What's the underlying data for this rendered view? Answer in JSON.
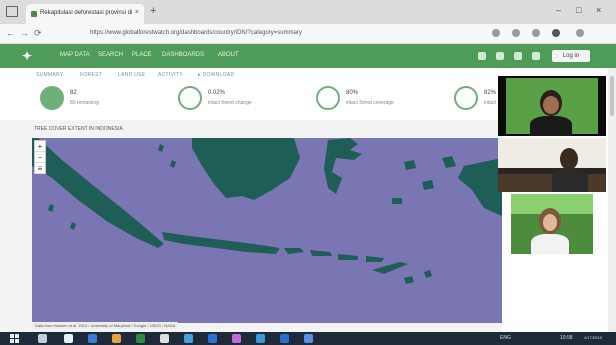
{
  "browser": {
    "tab_title": "Rekapitulasi deforestasi provinsi di",
    "tab_close": "×",
    "new_tab": "+",
    "window_controls": [
      "–",
      "□",
      "×"
    ],
    "url": "https://www.globalforestwatch.org/dashboards/country/IDN/?category=summary",
    "nav": [
      "←",
      "→",
      "⟳"
    ]
  },
  "app": {
    "logo": "✦",
    "menu": [
      "MAP DATA",
      "SEARCH",
      "PLACE",
      "DASHBOARDS",
      "ABOUT"
    ],
    "login_label": "Log in"
  },
  "subnav": [
    "SUMMARY",
    "FOREST",
    "LAND USE",
    "ACTIVITY",
    "▸ DOWNLOAD"
  ],
  "stats": [
    {
      "value": "82",
      "label": "80 remaining"
    },
    {
      "value": "0.02%",
      "label": "intact forest change"
    },
    {
      "value": "80%",
      "label": "intact forest coverage"
    },
    {
      "value": "82%",
      "label": "intact"
    }
  ],
  "section_title": "TREE COVER EXTENT IN INDONESIA",
  "map": {
    "zoom_in": "+",
    "zoom_out": "−",
    "layers": "≡",
    "attribution": "Data from Hansen et al. 2013 / University of Maryland / Google / USGS / NASA",
    "water_color": "#7a76b3",
    "land_color": "#1f5d57"
  },
  "video_participants": [
    "participant-1",
    "participant-2",
    "participant-3"
  ],
  "taskbar": {
    "time": "10:58",
    "date": "4/17/2019",
    "tray": [
      "ENG"
    ]
  }
}
